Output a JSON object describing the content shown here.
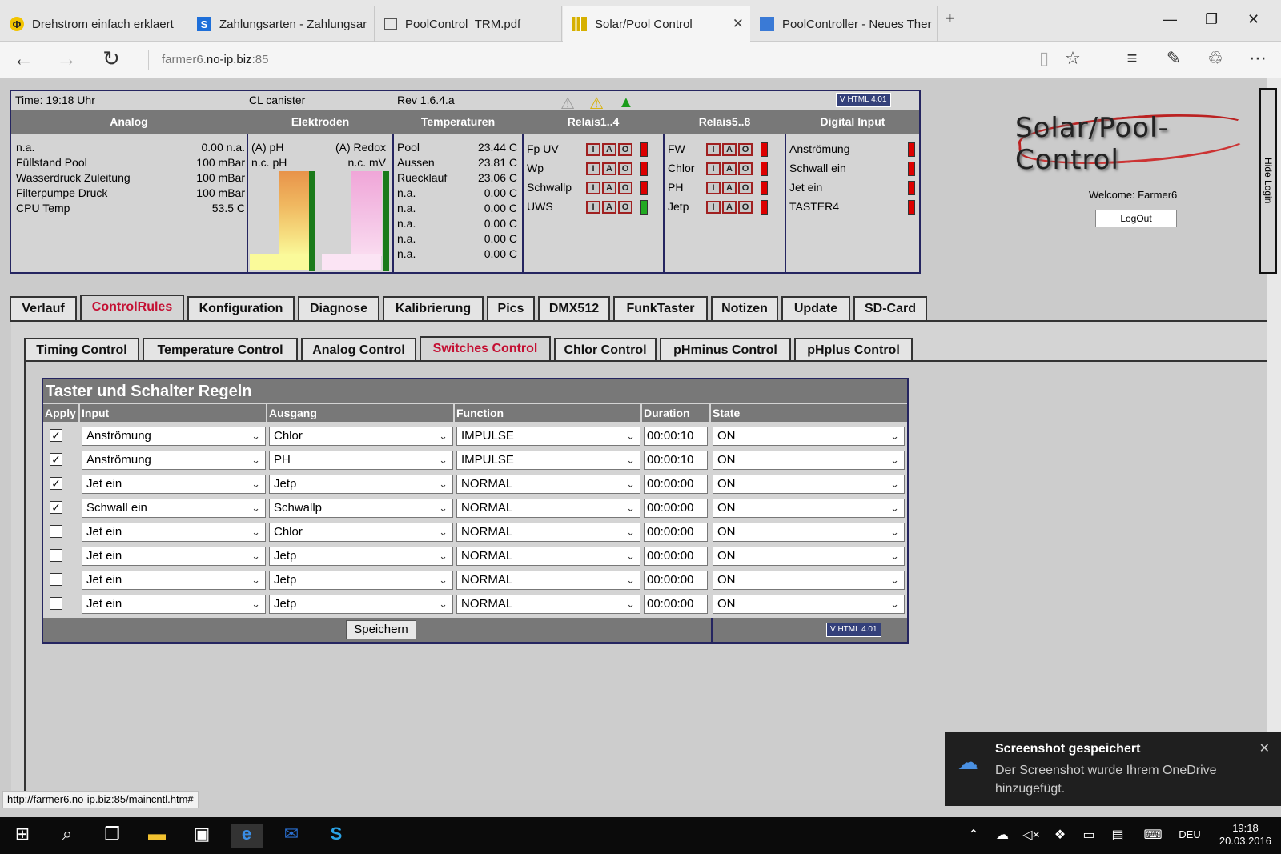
{
  "browser": {
    "tabs": [
      {
        "label": "Drehstrom einfach erklaert",
        "icon": "phi-icon"
      },
      {
        "label": "Zahlungsarten - Zahlungsar",
        "icon": "s-icon"
      },
      {
        "label": "PoolControl_TRM.pdf",
        "icon": "pdf-icon"
      },
      {
        "label": "Solar/Pool Control",
        "icon": "signal-icon"
      },
      {
        "label": "PoolController - Neues Ther",
        "icon": "site-icon"
      }
    ],
    "url_plain_start": "farmer6.",
    "url_host": "no-ip.biz",
    "url_port": ":85"
  },
  "status": {
    "time": "Time: 19:18 Uhr",
    "mode": "CL canister",
    "rev": "Rev 1.6.4.a",
    "badge": "V HTML 4.01",
    "headers": [
      "Analog",
      "Elektroden",
      "Temperaturen",
      "Relais1..4",
      "Relais5..8",
      "Digital Input"
    ],
    "analog": [
      {
        "name": "n.a.",
        "value": "0.00 n.a."
      },
      {
        "name": "Füllstand Pool",
        "value": "100 mBar"
      },
      {
        "name": "Wasserdruck Zuleitung",
        "value": "100 mBar"
      },
      {
        "name": "Filterpumpe Druck",
        "value": "100 mBar"
      },
      {
        "name": "CPU Temp",
        "value": "53.5 C"
      }
    ],
    "electrodes": {
      "ph_label": "(A) pH",
      "ph_sub": "n.c. pH",
      "redox_label": "(A) Redox",
      "redox_sub": "n.c. mV"
    },
    "temps": [
      {
        "name": "Pool",
        "value": "23.44 C"
      },
      {
        "name": "Aussen",
        "value": "23.81 C"
      },
      {
        "name": "Ruecklauf",
        "value": "23.06 C"
      },
      {
        "name": "n.a.",
        "value": "0.00 C"
      },
      {
        "name": "n.a.",
        "value": "0.00 C"
      },
      {
        "name": "n.a.",
        "value": "0.00 C"
      },
      {
        "name": "n.a.",
        "value": "0.00 C"
      },
      {
        "name": "n.a.",
        "value": "0.00 C"
      }
    ],
    "relay_buttons": [
      "I",
      "A",
      "O"
    ],
    "relais1": [
      {
        "name": "Fp UV",
        "led": "red"
      },
      {
        "name": "Wp",
        "led": "red"
      },
      {
        "name": "Schwallp",
        "led": "red"
      },
      {
        "name": "UWS",
        "led": "green"
      }
    ],
    "relais2": [
      {
        "name": "FW",
        "led": "red"
      },
      {
        "name": "Chlor",
        "led": "red"
      },
      {
        "name": "PH",
        "led": "red"
      },
      {
        "name": "Jetp",
        "led": "red"
      }
    ],
    "digital": [
      {
        "name": "Anströmung",
        "led": "red"
      },
      {
        "name": "Schwall ein",
        "led": "red"
      },
      {
        "name": "Jet ein",
        "led": "red"
      },
      {
        "name": "TASTER4",
        "led": "red"
      }
    ]
  },
  "login": {
    "logo": "Solar/Pool-Control",
    "welcome": "Welcome:  Farmer6",
    "logout": "LogOut",
    "hide": "Hide Login"
  },
  "main_tabs": [
    "Verlauf",
    "ControlRules",
    "Konfiguration",
    "Diagnose",
    "Kalibrierung",
    "Pics",
    "DMX512",
    "FunkTaster",
    "Notizen",
    "Update",
    "SD-Card"
  ],
  "sub_tabs": [
    "Timing Control",
    "Temperature Control",
    "Analog Control",
    "Switches Control",
    "Chlor Control",
    "pHminus Control",
    "pHplus Control"
  ],
  "switches": {
    "title": "Taster und Schalter Regeln",
    "columns": [
      "Apply",
      "Input",
      "Ausgang",
      "Function",
      "Duration",
      "State"
    ],
    "rows": [
      {
        "apply": true,
        "input": "Anströmung",
        "output": "Chlor",
        "function": "IMPULSE",
        "duration": "00:00:10",
        "state": "ON"
      },
      {
        "apply": true,
        "input": "Anströmung",
        "output": "PH",
        "function": "IMPULSE",
        "duration": "00:00:10",
        "state": "ON"
      },
      {
        "apply": true,
        "input": "Jet ein",
        "output": "Jetp",
        "function": "NORMAL",
        "duration": "00:00:00",
        "state": "ON"
      },
      {
        "apply": true,
        "input": "Schwall ein",
        "output": "Schwallp",
        "function": "NORMAL",
        "duration": "00:00:00",
        "state": "ON"
      },
      {
        "apply": false,
        "input": "Jet ein",
        "output": "Chlor",
        "function": "NORMAL",
        "duration": "00:00:00",
        "state": "ON"
      },
      {
        "apply": false,
        "input": "Jet ein",
        "output": "Jetp",
        "function": "NORMAL",
        "duration": "00:00:00",
        "state": "ON"
      },
      {
        "apply": false,
        "input": "Jet ein",
        "output": "Jetp",
        "function": "NORMAL",
        "duration": "00:00:00",
        "state": "ON"
      },
      {
        "apply": false,
        "input": "Jet ein",
        "output": "Jetp",
        "function": "NORMAL",
        "duration": "00:00:00",
        "state": "ON"
      }
    ],
    "save": "Speichern"
  },
  "status_url": "http://farmer6.no-ip.biz:85/maincntl.htm#",
  "toast": {
    "title": "Screenshot gespeichert",
    "body": "Der Screenshot wurde Ihrem OneDrive hinzugefügt."
  },
  "tray": {
    "lang": "DEU",
    "time": "19:18",
    "date": "20.03.2016"
  },
  "colors": {
    "accent": "#c41033",
    "header_gray": "#787878",
    "frame": "#252560"
  }
}
